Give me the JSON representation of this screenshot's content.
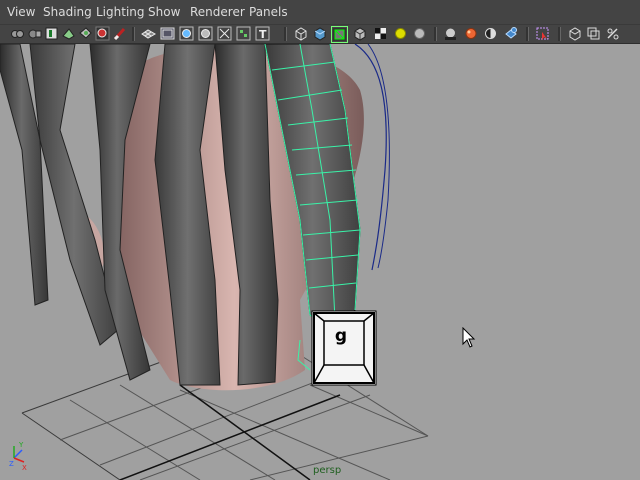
{
  "menubar": {
    "items": [
      "View",
      "Shading",
      "Lighting",
      "Show",
      "Renderer",
      "Panels"
    ]
  },
  "toolbar": {
    "icons": [
      "select-camera-icon",
      "lock-camera-icon",
      "bookmark-icon",
      "image-plane-icon",
      "2d-pan-zoom-icon",
      "grease-pencil-icon",
      "grid-icon",
      "film-gate-icon",
      "resolution-gate-icon",
      "gate-mask-icon",
      "field-chart-icon",
      "safe-action-icon",
      "safe-title-icon",
      "wireframe-icon",
      "smooth-shade-icon",
      "wireframe-on-shaded-icon",
      "textured-icon",
      "use-all-lights-icon",
      "shadows-icon",
      "screen-space-ao-icon",
      "motion-blur-icon",
      "multisample-aa-icon",
      "depth-of-field-icon",
      "isolate-select-icon",
      "xray-icon",
      "xray-joints-icon",
      "xray-components-icon"
    ]
  },
  "viewport": {
    "camera_label": "persp"
  },
  "overlay": {
    "key_hint": "g"
  },
  "colors": {
    "menubar_bg": "#444444",
    "viewport_bg": "#a0a0a0",
    "wireframe_highlight": "#3af2a8",
    "curve": "#1a2a88"
  }
}
